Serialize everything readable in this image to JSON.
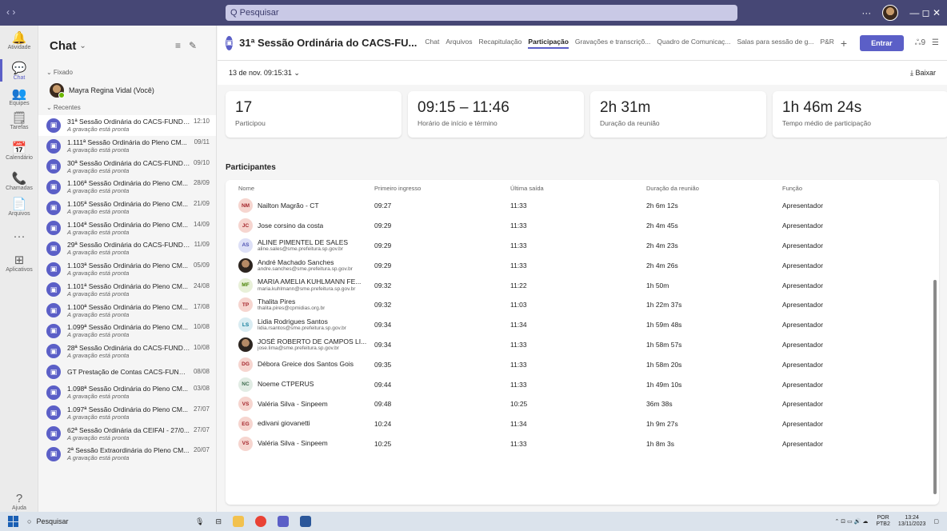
{
  "window": {
    "nav": "‹  ›",
    "search_placeholder": "Q Pesquisar",
    "more": "···",
    "controls": "—   ◻   ✕"
  },
  "rail": [
    {
      "label": "Atividade",
      "icon": "bell-icon",
      "glyph": "🔔"
    },
    {
      "label": "Chat",
      "icon": "chat-icon",
      "glyph": "💬"
    },
    {
      "label": "Equipes",
      "icon": "teams-icon",
      "glyph": "👥"
    },
    {
      "label": "Tarefas",
      "icon": "tasks-icon",
      "glyph": "🗒"
    },
    {
      "label": "Calendário",
      "icon": "calendar-icon",
      "glyph": "📅"
    },
    {
      "label": "Chamadas",
      "icon": "phone-icon",
      "glyph": "📞"
    },
    {
      "label": "Arquivos",
      "icon": "file-icon",
      "glyph": "📄"
    },
    {
      "label": "",
      "icon": "more-icon",
      "glyph": "···"
    },
    {
      "label": "Aplicativos",
      "icon": "apps-icon",
      "glyph": "⊞"
    },
    {
      "label": "Ajuda",
      "icon": "help-icon",
      "glyph": "?"
    }
  ],
  "chatlist": {
    "title": "Chat",
    "pinned_label": "⌄ Fixado",
    "pinned_user": "Mayra Regina Vidal (Você)",
    "recent_label": "⌄ Recentes",
    "items": [
      {
        "name": "31ª Sessão Ordinária do CACS-FUNDE...",
        "date": "12:10",
        "sub": "A gravação está pronta"
      },
      {
        "name": "1.111ª Sessão Ordinária do Pleno CM...",
        "date": "09/11",
        "sub": "A gravação está pronta"
      },
      {
        "name": "30ª Sessão Ordinária do CACS-FUNDE...",
        "date": "09/10",
        "sub": "A gravação está pronta"
      },
      {
        "name": "1.106ª Sessão Ordinária do Pleno CM...",
        "date": "28/09",
        "sub": "A gravação está pronta"
      },
      {
        "name": "1.105ª Sessão Ordinária do Pleno CM...",
        "date": "21/09",
        "sub": "A gravação está pronta"
      },
      {
        "name": "1.104ª Sessão Ordinária do Pleno CM...",
        "date": "14/09",
        "sub": "A gravação está pronta"
      },
      {
        "name": "29ª Sessão Ordinária do CACS-FUNDE...",
        "date": "11/09",
        "sub": "A gravação está pronta"
      },
      {
        "name": "1.103ª Sessão Ordinária do Pleno CM...",
        "date": "05/09",
        "sub": "A gravação está pronta"
      },
      {
        "name": "1.101ª Sessão Ordinária do Pleno CM...",
        "date": "24/08",
        "sub": "A gravação está pronta"
      },
      {
        "name": "1.100ª Sessão Ordinária do Pleno CM...",
        "date": "17/08",
        "sub": "A gravação está pronta"
      },
      {
        "name": "1.099ª Sessão Ordinária do Pleno CM...",
        "date": "10/08",
        "sub": "A gravação está pronta"
      },
      {
        "name": "28ª Sessão Ordinária do CACS-FUNDE...",
        "date": "10/08",
        "sub": "A gravação está pronta"
      },
      {
        "name": "GT Prestação de Contas CACS-FUNDEB",
        "date": "08/08",
        "sub": ""
      },
      {
        "name": "1.098ª Sessão Ordinária do Pleno CM...",
        "date": "03/08",
        "sub": "A gravação está pronta"
      },
      {
        "name": "1.097ª Sessão Ordinária do Pleno CM...",
        "date": "27/07",
        "sub": "A gravação está pronta"
      },
      {
        "name": "62ª Sessão Ordinária da CEIFAI - 27/0...",
        "date": "27/07",
        "sub": "A gravação está pronta"
      },
      {
        "name": "2ª Sessão Extraordinária do Pleno CM...",
        "date": "20/07",
        "sub": "A gravação está pronta"
      }
    ]
  },
  "meeting": {
    "title": "31ª Sessão Ordinária do CACS-FU...",
    "tabs": [
      "Chat",
      "Arquivos",
      "Recapitulação",
      "Participação",
      "Gravações e transcriçõ...",
      "Quadro de Comunicaç...",
      "Salas para sessão de g...",
      "P&R"
    ],
    "active_tab": "Participação",
    "join_label": "Entrar",
    "people_count": "ஃ9"
  },
  "subbar": {
    "session": "13 de nov. 09:15:31  ⌄",
    "download": "⤓  Baixar"
  },
  "stats": [
    {
      "value": "17",
      "label": "Participou"
    },
    {
      "value": "09:15 – 11:46",
      "label": "Horário de início e término"
    },
    {
      "value": "2h 31m",
      "label": "Duração da reunião"
    },
    {
      "value": "1h 46m 24s",
      "label": "Tempo médio de participação"
    }
  ],
  "participants": {
    "title": "Participantes",
    "columns": [
      "Nome",
      "Primeiro ingresso",
      "Última saída",
      "Duração da reunião",
      "Função"
    ],
    "rows": [
      {
        "initials": "NM",
        "color": "#f6d5cf",
        "fg": "#a4262c",
        "name": "Nailton Magrão - CT",
        "email": "",
        "in": "09:27",
        "out": "11:33",
        "dur": "2h 6m 12s",
        "role": "Apresentador"
      },
      {
        "initials": "JC",
        "color": "#f6d5cf",
        "fg": "#a4262c",
        "name": "Jose corsino da costa",
        "email": "",
        "in": "09:29",
        "out": "11:33",
        "dur": "2h 4m 45s",
        "role": "Apresentador"
      },
      {
        "initials": "AS",
        "color": "#dde0f7",
        "fg": "#4f52b2",
        "name": "ALINE PIMENTEL DE SALES",
        "email": "aline.sales@sme.prefeitura.sp.gov.br",
        "in": "09:29",
        "out": "11:33",
        "dur": "2h 4m 23s",
        "role": "Apresentador"
      },
      {
        "initials": "",
        "color": "photo",
        "fg": "",
        "name": "André Machado Sanches",
        "email": "andre.sanches@sme.prefeitura.sp.gov.br",
        "in": "09:29",
        "out": "11:33",
        "dur": "2h 4m 26s",
        "role": "Apresentador"
      },
      {
        "initials": "MF",
        "color": "#e8f0d8",
        "fg": "#498205",
        "name": "MARIA AMELIA KUHLMANN FE...",
        "email": "maria.kuhlmann@sme.prefeitura.sp.gov.br",
        "in": "09:32",
        "out": "11:22",
        "dur": "1h 50m",
        "role": "Apresentador"
      },
      {
        "initials": "TP",
        "color": "#f6d5cf",
        "fg": "#a4262c",
        "name": "Thalita Pires",
        "email": "thalita.pires@cpmidias.org.br",
        "in": "09:32",
        "out": "11:03",
        "dur": "1h 22m 37s",
        "role": "Apresentador"
      },
      {
        "initials": "LS",
        "color": "#d9ecf2",
        "fg": "#0e7a99",
        "name": "Lidia Rodrigues Santos",
        "email": "lidia.rsantos@sme.prefeitura.sp.gov.br",
        "in": "09:34",
        "out": "11:34",
        "dur": "1h 59m 48s",
        "role": "Apresentador"
      },
      {
        "initials": "",
        "color": "photo",
        "fg": "",
        "name": "JOSÉ ROBERTO DE CAMPOS LI...",
        "email": "jose.lima@sme.prefeitura.sp.gov.br",
        "in": "09:34",
        "out": "11:33",
        "dur": "1h 58m 57s",
        "role": "Apresentador"
      },
      {
        "initials": "DG",
        "color": "#f6d5cf",
        "fg": "#a4262c",
        "name": "Débora Greice dos Santos Gois",
        "email": "",
        "in": "09:35",
        "out": "11:33",
        "dur": "1h 58m 20s",
        "role": "Apresentador"
      },
      {
        "initials": "NC",
        "color": "#e1ece4",
        "fg": "#3d6b4e",
        "name": "Noeme CTPERUS",
        "email": "",
        "in": "09:44",
        "out": "11:33",
        "dur": "1h 49m 10s",
        "role": "Apresentador"
      },
      {
        "initials": "VS",
        "color": "#f6d5cf",
        "fg": "#a4262c",
        "name": "Valéria Silva - Sinpeem",
        "email": "",
        "in": "09:48",
        "out": "10:25",
        "dur": "36m 38s",
        "role": "Apresentador"
      },
      {
        "initials": "EG",
        "color": "#f6d5cf",
        "fg": "#a4262c",
        "name": "edivani giovanetti",
        "email": "",
        "in": "10:24",
        "out": "11:34",
        "dur": "1h 9m 27s",
        "role": "Apresentador"
      },
      {
        "initials": "VS",
        "color": "#f6d5cf",
        "fg": "#a4262c",
        "name": "Valéria Silva - Sinpeem",
        "email": "",
        "in": "10:25",
        "out": "11:33",
        "dur": "1h 8m 3s",
        "role": "Apresentador"
      }
    ]
  },
  "taskbar": {
    "search": "Pesquisar",
    "lang": "POR",
    "lang2": "PTB2",
    "time": "13:24",
    "date": "13/11/2023"
  }
}
